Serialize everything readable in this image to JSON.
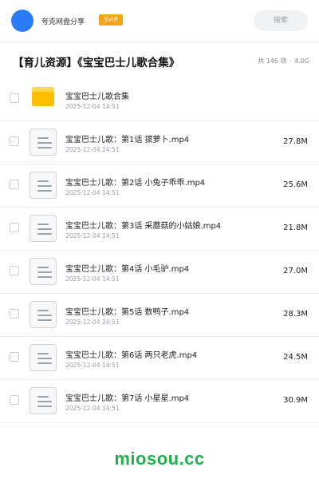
{
  "header": {
    "brand": "夸克网盘分享",
    "badge": "SVIP",
    "search_placeholder": "搜索",
    "avatar_color": "#2a7cf6",
    "badge_color": "#f6a21a"
  },
  "share": {
    "title": "【育儿资源】《宝宝巴士儿歌合集》",
    "count": "共 146 项",
    "sep": "·",
    "total_size": "4.0G"
  },
  "items": [
    {
      "type": "folder",
      "name": "宝宝巴士儿歌合集",
      "date": "2025-12-04 14:51",
      "size": ""
    },
    {
      "type": "file",
      "name": "宝宝巴士儿歌：第1话 拔萝卜.mp4",
      "date": "2025-12-04 14:51",
      "size": "27.8M"
    },
    {
      "type": "file",
      "name": "宝宝巴士儿歌：第2话 小兔子乖乖.mp4",
      "date": "2025-12-04 14:51",
      "size": "25.6M"
    },
    {
      "type": "file",
      "name": "宝宝巴士儿歌：第3话 采蘑菇的小姑娘.mp4",
      "date": "2025-12-04 14:51",
      "size": "21.8M"
    },
    {
      "type": "file",
      "name": "宝宝巴士儿歌：第4话 小毛驴.mp4",
      "date": "2025-12-04 14:51",
      "size": "27.0M"
    },
    {
      "type": "file",
      "name": "宝宝巴士儿歌：第5话 数鸭子.mp4",
      "date": "2025-12-04 14:51",
      "size": "28.3M"
    },
    {
      "type": "file",
      "name": "宝宝巴士儿歌：第6话 两只老虎.mp4",
      "date": "2025-12-04 14:51",
      "size": "24.5M"
    },
    {
      "type": "file",
      "name": "宝宝巴士儿歌：第7话 小星星.mp4",
      "date": "2025-12-04 14:51",
      "size": "30.9M"
    }
  ],
  "watermark": "miosou.cc",
  "watermark_color": "#22b04b"
}
